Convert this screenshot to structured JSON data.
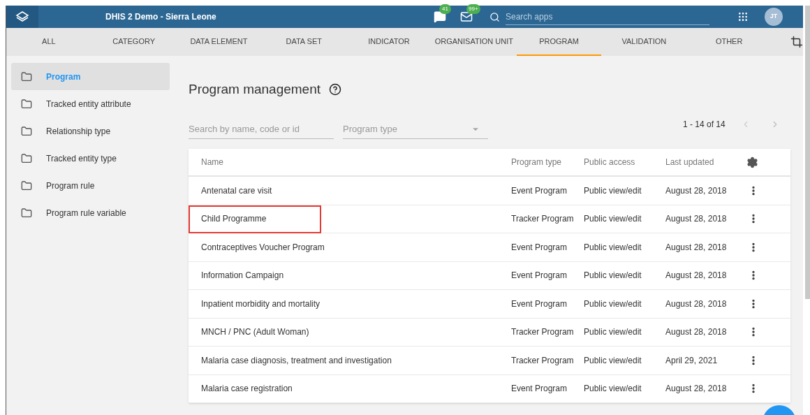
{
  "header": {
    "title": "DHIS 2 Demo - Sierra Leone",
    "messages_count": "41",
    "mail_count": "99+",
    "search": {
      "placeholder": "Search apps"
    },
    "avatar": "JT"
  },
  "tabs": [
    {
      "label": "ALL",
      "selected": false
    },
    {
      "label": "CATEGORY",
      "selected": false
    },
    {
      "label": "DATA ELEMENT",
      "selected": false
    },
    {
      "label": "DATA SET",
      "selected": false
    },
    {
      "label": "INDICATOR",
      "selected": false
    },
    {
      "label": "ORGANISATION UNIT",
      "selected": false
    },
    {
      "label": "PROGRAM",
      "selected": true
    },
    {
      "label": "VALIDATION",
      "selected": false
    },
    {
      "label": "OTHER",
      "selected": false
    }
  ],
  "sidebar": {
    "items": [
      {
        "label": "Program",
        "selected": true
      },
      {
        "label": "Tracked entity attribute",
        "selected": false
      },
      {
        "label": "Relationship type",
        "selected": false
      },
      {
        "label": "Tracked entity type",
        "selected": false
      },
      {
        "label": "Program rule",
        "selected": false
      },
      {
        "label": "Program rule variable",
        "selected": false
      }
    ]
  },
  "page_title": "Program management",
  "filters": {
    "search": {
      "placeholder": "Search by name, code or id"
    },
    "program_type": {
      "placeholder": "Program type"
    }
  },
  "pagination": "1 - 14 of 14",
  "table": {
    "columns": [
      "Name",
      "Program type",
      "Public access",
      "Last updated"
    ],
    "rows": [
      {
        "cells": [
          "Antenatal care visit",
          "Event Program",
          "Public view/edit",
          "August 28, 2018"
        ],
        "highlighted": false
      },
      {
        "cells": [
          "Child Programme",
          "Tracker Program",
          "Public view/edit",
          "August 28, 2018"
        ],
        "highlighted": true
      },
      {
        "cells": [
          "Contraceptives Voucher Program",
          "Event Program",
          "Public view/edit",
          "August 28, 2018"
        ],
        "highlighted": false
      },
      {
        "cells": [
          "Information Campaign",
          "Event Program",
          "Public view/edit",
          "August 28, 2018"
        ],
        "highlighted": false
      },
      {
        "cells": [
          "Inpatient morbidity and mortality",
          "Event Program",
          "Public view/edit",
          "August 28, 2018"
        ],
        "highlighted": false
      },
      {
        "cells": [
          "MNCH / PNC (Adult Woman)",
          "Tracker Program",
          "Public view/edit",
          "August 28, 2018"
        ],
        "highlighted": false
      },
      {
        "cells": [
          "Malaria case diagnosis, treatment and investigation",
          "Tracker Program",
          "Public view/edit",
          "April 29, 2021"
        ],
        "highlighted": false
      },
      {
        "cells": [
          "Malaria case registration",
          "Event Program",
          "Public view/edit",
          "August 28, 2018"
        ],
        "highlighted": false
      }
    ]
  }
}
